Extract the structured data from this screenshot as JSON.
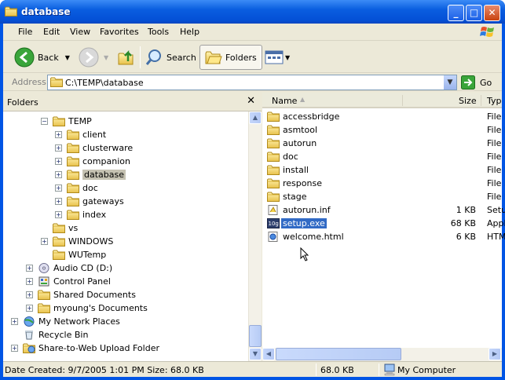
{
  "window": {
    "title": "database"
  },
  "menu": [
    "File",
    "Edit",
    "View",
    "Favorites",
    "Tools",
    "Help"
  ],
  "toolbar": {
    "back_label": "Back",
    "search_label": "Search",
    "folders_label": "Folders"
  },
  "address": {
    "label": "Address",
    "value": "C:\\TEMP\\database",
    "go_label": "Go"
  },
  "folders_pane": {
    "title": "Folders",
    "close_glyph": "✕",
    "tree": [
      {
        "label": "TEMP",
        "expander": "−",
        "icon": "folder-open-icon"
      },
      {
        "label": "client",
        "expander": "+",
        "icon": "folder-icon"
      },
      {
        "label": "clusterware",
        "expander": "+",
        "icon": "folder-icon"
      },
      {
        "label": "companion",
        "expander": "+",
        "icon": "folder-icon"
      },
      {
        "label": "database",
        "expander": "+",
        "icon": "folder-icon",
        "selected": true
      },
      {
        "label": "doc",
        "expander": "+",
        "icon": "folder-icon"
      },
      {
        "label": "gateways",
        "expander": "+",
        "icon": "folder-icon"
      },
      {
        "label": "index",
        "expander": "+",
        "icon": "folder-icon"
      },
      {
        "label": "vs",
        "expander": "",
        "icon": "folder-icon"
      },
      {
        "label": "WINDOWS",
        "expander": "+",
        "icon": "folder-icon"
      },
      {
        "label": "WUTemp",
        "expander": "",
        "icon": "folder-icon"
      },
      {
        "label": "Audio CD (D:)",
        "expander": "+",
        "icon": "cd-drive-icon"
      },
      {
        "label": "Control Panel",
        "expander": "+",
        "icon": "control-panel-icon"
      },
      {
        "label": "Shared Documents",
        "expander": "+",
        "icon": "folder-icon"
      },
      {
        "label": "myoung's Documents",
        "expander": "+",
        "icon": "folder-icon"
      },
      {
        "label": "My Network Places",
        "expander": "+",
        "icon": "network-icon"
      },
      {
        "label": "Recycle Bin",
        "expander": "",
        "icon": "recycle-bin-icon"
      },
      {
        "label": "Share-to-Web Upload Folder",
        "expander": "+",
        "icon": "web-folder-icon"
      }
    ]
  },
  "file_list": {
    "columns": {
      "name": "Name",
      "size": "Size",
      "type": "Typ"
    },
    "rows": [
      {
        "name": "accessbridge",
        "size": "",
        "type": "File F",
        "icon": "folder-icon"
      },
      {
        "name": "asmtool",
        "size": "",
        "type": "File F",
        "icon": "folder-icon"
      },
      {
        "name": "autorun",
        "size": "",
        "type": "File F",
        "icon": "folder-icon"
      },
      {
        "name": "doc",
        "size": "",
        "type": "File F",
        "icon": "folder-icon"
      },
      {
        "name": "install",
        "size": "",
        "type": "File F",
        "icon": "folder-icon"
      },
      {
        "name": "response",
        "size": "",
        "type": "File F",
        "icon": "folder-icon"
      },
      {
        "name": "stage",
        "size": "",
        "type": "File F",
        "icon": "folder-icon"
      },
      {
        "name": "autorun.inf",
        "size": "1 KB",
        "type": "Setu",
        "icon": "setup-info-icon"
      },
      {
        "name": "setup.exe",
        "size": "68 KB",
        "type": "Appli",
        "icon": "oracle-setup-icon",
        "selected": true
      },
      {
        "name": "welcome.html",
        "size": "6 KB",
        "type": "HTM",
        "icon": "html-file-icon"
      }
    ]
  },
  "status": {
    "details": "Date Created: 9/7/2005 1:01 PM Size: 68.0 KB",
    "size": "68.0 KB",
    "location": "My Computer"
  }
}
